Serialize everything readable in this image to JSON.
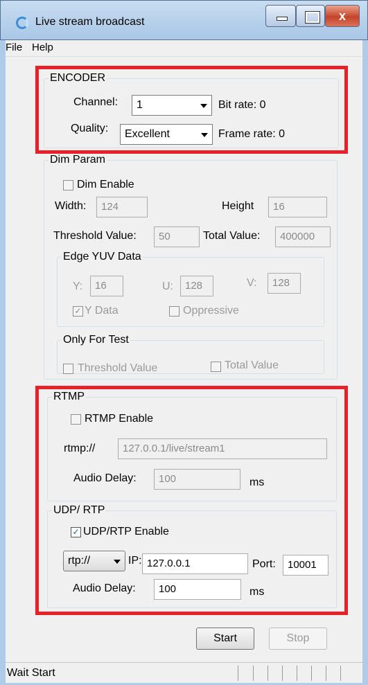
{
  "window": {
    "title": "Live stream broadcast",
    "close_glyph": "x"
  },
  "menu": [
    "File",
    "Help"
  ],
  "encoder": {
    "legend": "ENCODER",
    "channel_label": "Channel:",
    "channel_value": "1",
    "bitrate": "Bit rate: 0",
    "quality_label": "Quality:",
    "quality_value": "Excellent",
    "framerate": "Frame rate: 0"
  },
  "dim": {
    "legend": "Dim Param",
    "enable": "Dim Enable",
    "width_label": "Width:",
    "width_value": "124",
    "height_label": "Height",
    "height_value": "16",
    "threshold_label": "Threshold Value:",
    "threshold_value": "50",
    "total_label": "Total Value:",
    "total_value": "400000"
  },
  "edge": {
    "legend": "Edge YUV Data",
    "y_label": "Y:",
    "y_value": "16",
    "u_label": "U:",
    "u_value": "128",
    "v_label": "V:",
    "v_value": "128",
    "ydata": "Y Data",
    "oppressive": "Oppressive"
  },
  "test": {
    "legend": "Only For Test",
    "threshold": "Threshold Value",
    "total": "Total Value"
  },
  "rtmp": {
    "legend": "RTMP",
    "enable": "RTMP Enable",
    "url_label": "rtmp://",
    "url_value": "127.0.0.1/live/stream1",
    "delay_label": "Audio Delay:",
    "delay_value": "100",
    "ms": "ms"
  },
  "udp": {
    "legend": "UDP/ RTP",
    "enable": "UDP/RTP Enable",
    "proto": "rtp://",
    "ip_label": "IP:",
    "ip_value": "127.0.0.1",
    "port_label": "Port:",
    "port_value": "10001",
    "delay_label": "Audio Delay:",
    "delay_value": "100",
    "ms": "ms"
  },
  "buttons": {
    "start": "Start",
    "stop": "Stop"
  },
  "status": "Wait Start",
  "colors": {
    "highlight": "#e8202a",
    "titlebar": "#a9c7e6"
  }
}
